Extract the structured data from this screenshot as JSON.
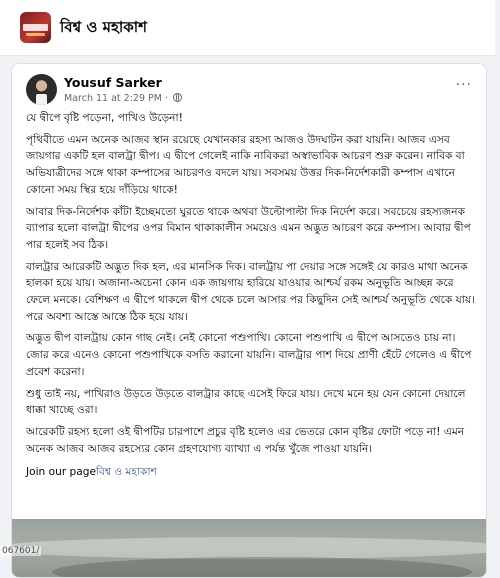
{
  "topbar": {
    "page_name": "বিশ্ব ও মহাকাশ",
    "logo_icon": "page-logo-icon"
  },
  "post": {
    "author": "Yousuf Sarker",
    "timestamp": "March 11 at 2:29 PM ·",
    "audience_icon": "globe-icon",
    "more_label": "···",
    "paragraphs": [
      "যে দ্বীপে বৃষ্টি পড়েনা, পাখিও উড়েনা!",
      "পৃথিবীতে এমন অনেক আজব স্থান রয়েছে যেখানকার রহস্য আজও উদঘাটন করা যায়নি। আজব এসব জায়গার একটি হল বালট্রা দ্বীপ। এ দ্বীপে গেলেই নাকি নাবিকরা অস্বাভাবিক আচরণ শুরু করেন। নাবিক বা অভিযাত্রীদের সঙ্গে থাকা কম্পাসের আচরণও বদলে যায়। সবসময় উত্তর দিক-নির্দেশকারী কম্পাস এখানে কোনো সময় স্থির হয়ে দাঁড়িয়ে থাকে!",
      "আবার দিক-নির্দেশক কাঁটা ইচ্ছেমতো ঘুরতে থাকে অথবা উল্টোপাল্টা দিক নির্দেশ করে। সবচেয়ে রহস্যজনক ব্যাপার হলো বালট্রা দ্বীপের ওপর বিমান থাকাকালীন সময়েও এমন অদ্ভুত আচরণ করে কম্পাস। আবার দ্বীপ পার হলেই সব ঠিক।",
      "বালট্রার আরেকটি অদ্ভুত দিক হল, এর মানসিক দিক। বালট্রায় পা দেয়ার সঙ্গে সঙ্গেই যে কারও মাথা অনেক হালকা হয়ে যায়। অজানা-অচেনা কোন এক জায়গায় হারিয়ে যাওয়ার আশ্চর্য রকম অনুভূতি আচ্ছন্ন করে ফেলে মনকে। বেশিক্ষণ এ দ্বীপে থাকলে দ্বীপ থেকে চলে আসার পর কিছুদিন সেই আশ্চর্য অনুভূতি থেকে যায়। পরে অবশ্য আস্তে আস্তে ঠিক হয়ে যায়।",
      "অদ্ভুত দ্বীপ বালট্রায় কোন গাছ নেই। নেই কোনো পশুপাখি। কোনো পশুপাখি এ দ্বীপে আসতেও চায় না। জোর করে এনেও কোনো পশুপাখিকে বসতি করানো যায়নি। বালট্রার পাশ দিয়ে প্রাণী হেঁটে গেলেও এ দ্বীপে প্রবেশ করেনা।",
      "শুধু তাই নয়, পাখিরাও উড়তে উড়তে বালট্রার কাছে এসেই ফিরে যায়। দেখে মনে হয় যেন কোনো দেয়ালে ধাক্কা খাচ্ছে ওরা।",
      "আরেকটি রহস্য হলো ওই দ্বীপটির চারপাশে প্রচুর বৃষ্টি হলেও এর ভেতরে কোন বৃষ্টির ফোটা পড়ে না! এমন অনেক আজব আজব রহস্যের কোন গ্রহণযোগ্য ব্যাখ্যা এ পর্যন্ত খুঁজে পাওয়া যায়নি।"
    ],
    "join_prefix": "Join our page",
    "join_link": "বিশ্ব ও মহাকাশ"
  },
  "watermark": "067601/"
}
